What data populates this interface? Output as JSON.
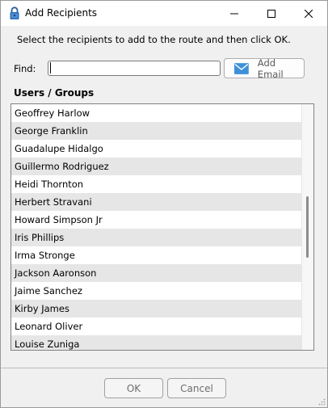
{
  "window": {
    "title": "Add Recipients",
    "title_icon": "lock-icon",
    "controls": [
      "minimize-icon",
      "maximize-icon",
      "close-icon"
    ]
  },
  "instruction": "Select the recipients to add to the route and then click OK.",
  "find": {
    "label": "Find:",
    "value": "",
    "placeholder": ""
  },
  "add_email": {
    "label": "Add Email",
    "icon": "envelope-icon",
    "icon_color": "#3e90d9"
  },
  "users": {
    "section_label": "Users / Groups",
    "items": [
      "Geoffrey Harlow",
      "George Franklin",
      "Guadalupe Hidalgo",
      "Guillermo Rodriguez",
      "Heidi Thornton",
      "Herbert Stravani",
      "Howard Simpson Jr",
      "Iris Phillips",
      "Irma Stronge",
      "Jackson Aaronson",
      "Jaime Sanchez",
      "Kirby James",
      "Leonard Oliver",
      "Louise Zuniga"
    ],
    "alt_row_color": "#e6e6e6",
    "scroll_position": 0.5,
    "visible_fraction": 0.25
  },
  "footer": {
    "ok_label": "OK",
    "cancel_label": "Cancel"
  }
}
